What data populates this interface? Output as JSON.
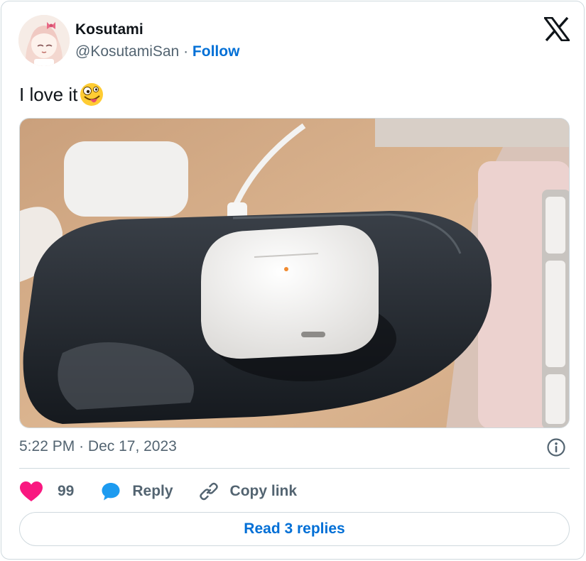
{
  "author": {
    "display_name": "Kosutami",
    "handle": "@KosutamiSan",
    "separator": "·",
    "follow_label": "Follow",
    "avatar_icon": "anime-avatar"
  },
  "tweet": {
    "text": "I love it",
    "emoji": "zany-face-emoji",
    "media_description": "photo-white-earbuds-case-on-wireless-charging-pad",
    "time": "5:22 PM",
    "date_separator": "·",
    "date": "Dec 17, 2023"
  },
  "actions": {
    "like_count": "99",
    "reply_label": "Reply",
    "copy_link_label": "Copy link"
  },
  "read_replies_label": "Read 3 replies",
  "colors": {
    "like": "#f91880",
    "reply": "#1d9bf0",
    "link": "#006fd6",
    "muted": "#536471",
    "border": "#cfd9de"
  }
}
